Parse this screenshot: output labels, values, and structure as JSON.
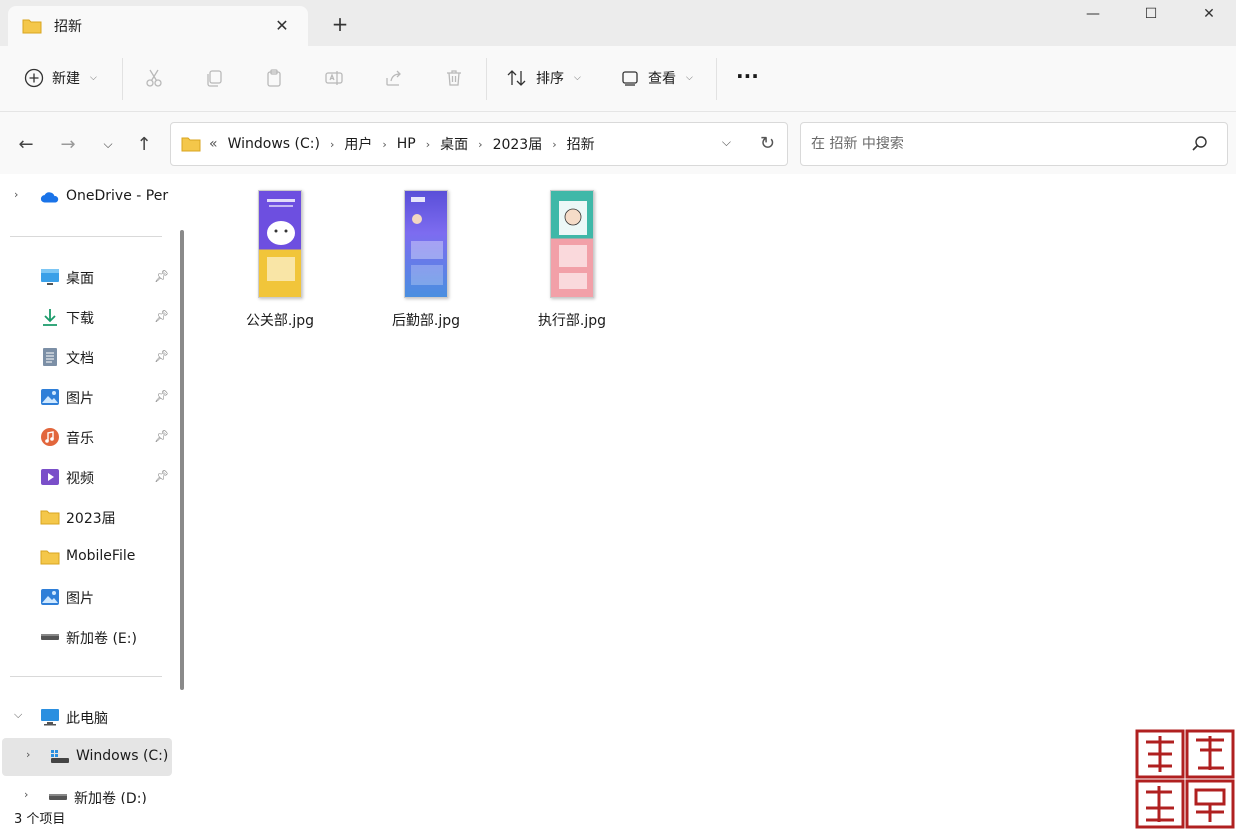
{
  "window": {
    "tab_title": "招新",
    "new_tab_label": "+",
    "minimize": "—",
    "maximize": "☐",
    "close": "✕"
  },
  "toolbar": {
    "new_label": "新建",
    "sort_label": "排序",
    "view_label": "查看",
    "more_label": "···"
  },
  "address": {
    "crumbs": [
      "Windows (C:)",
      "用户",
      "HP",
      "桌面",
      "2023届",
      "招新"
    ],
    "overflow": "«"
  },
  "search": {
    "placeholder": "在 招新 中搜索"
  },
  "sidebar": {
    "onedrive": "OneDrive - Per",
    "quick": [
      {
        "label": "桌面",
        "icon": "desktop-icon"
      },
      {
        "label": "下载",
        "icon": "download-icon"
      },
      {
        "label": "文档",
        "icon": "document-icon"
      },
      {
        "label": "图片",
        "icon": "pictures-icon"
      },
      {
        "label": "音乐",
        "icon": "music-icon"
      },
      {
        "label": "视频",
        "icon": "video-icon"
      }
    ],
    "folders": [
      "2023届",
      "MobileFile",
      "图片",
      "新加卷 (E:)"
    ],
    "this_pc": "此电脑",
    "drive_c": "Windows (C:)",
    "drive_d": "新加卷 (D:)"
  },
  "files": [
    {
      "name": "公关部.jpg"
    },
    {
      "name": "后勤部.jpg"
    },
    {
      "name": "执行部.jpg"
    }
  ],
  "status": {
    "count": "3 个项目"
  },
  "colors": {
    "folder": "#f4c74a",
    "accent": "#0067c0",
    "onedrive": "#1a73e8"
  }
}
